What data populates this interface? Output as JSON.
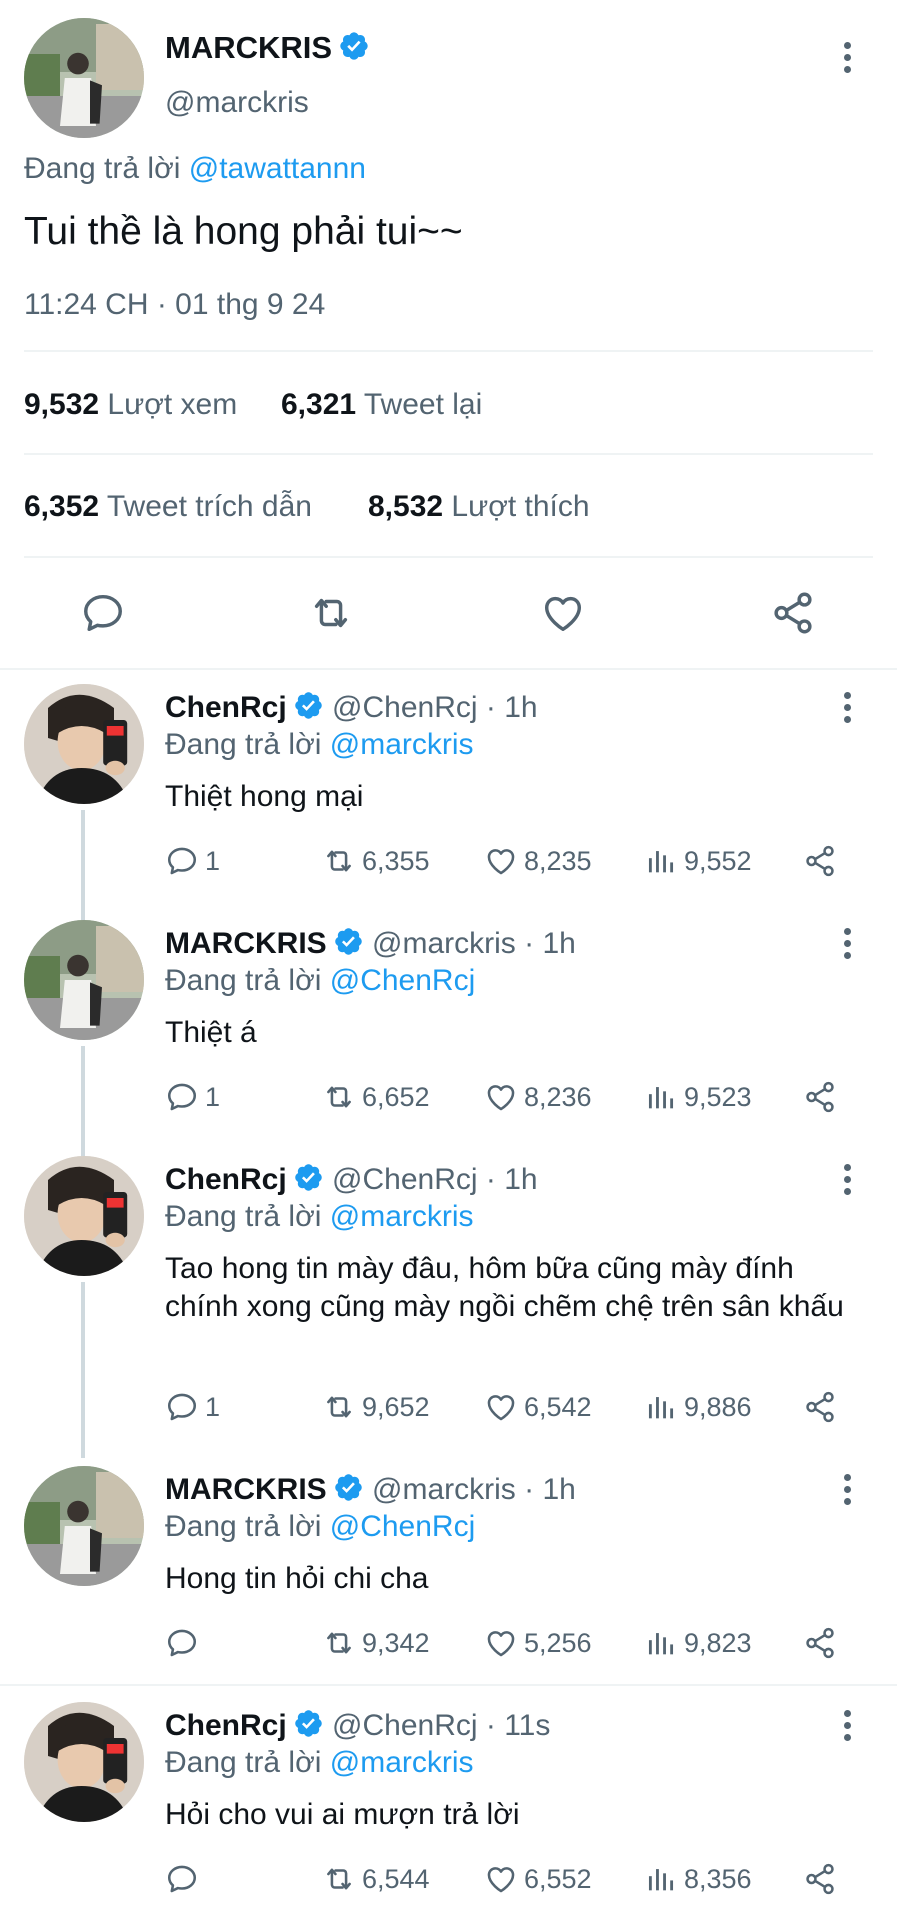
{
  "main_tweet": {
    "display_name": "MARCKRIS",
    "handle": "@marckris",
    "replying_prefix": "Đang trả lời",
    "replying_to": "@tawattannn",
    "text": "Tui thề là hong phải tui~~",
    "timestamp": "11:24 CH · 01 thg 9 24",
    "views_count": "9,532",
    "views_label": "Lượt xem",
    "retweets_count": "6,321",
    "retweets_label": "Tweet lại",
    "quotes_count": "6,352",
    "quotes_label": "Tweet trích dẫn",
    "likes_count": "8,532",
    "likes_label": "Lượt thích",
    "actions": [
      "reply-icon",
      "retweet-icon",
      "like-icon",
      "share-icon"
    ]
  },
  "replies": [
    {
      "display_name": "ChenRcj",
      "handle": "@ChenRcj",
      "time": "· 1h",
      "replying_prefix": "Đang trả lời",
      "replying_to": "@marckris",
      "text": "Thiệt hong mại",
      "replies": "1",
      "retweets": "6,355",
      "likes": "8,235",
      "views": "9,552"
    },
    {
      "display_name": "MARCKRIS",
      "handle": "@marckris",
      "time": "· 1h",
      "replying_prefix": "Đang trả lời",
      "replying_to": "@ChenRcj",
      "text": "Thiệt á",
      "replies": "1",
      "retweets": "6,652",
      "likes": "8,236",
      "views": "9,523"
    },
    {
      "display_name": "ChenRcj",
      "handle": "@ChenRcj",
      "time": "· 1h",
      "replying_prefix": "Đang trả lời",
      "replying_to": "@marckris",
      "text": "Tao hong tin mày đâu, hôm bữa cũng mày đính chính xong cũng mày ngồi chẽm chệ trên sân khấu",
      "replies": "1",
      "retweets": "9,652",
      "likes": "6,542",
      "views": "9,886"
    },
    {
      "display_name": "MARCKRIS",
      "handle": "@marckris",
      "time": "· 1h",
      "replying_prefix": "Đang trả lời",
      "replying_to": "@ChenRcj",
      "text": "Hong tin hỏi chi cha",
      "replies": "",
      "retweets": "9,342",
      "likes": "5,256",
      "views": "9,823"
    },
    {
      "display_name": "ChenRcj",
      "handle": "@ChenRcj",
      "time": "· 11s",
      "replying_prefix": "Đang trả lời",
      "replying_to": "@marckris",
      "text": "Hỏi cho vui ai mượn trả lời",
      "replies": "",
      "retweets": "6,544",
      "likes": "6,552",
      "views": "8,356"
    }
  ],
  "colors": {
    "accent": "#1d9bf0",
    "text": "#0f1419",
    "muted": "#536471",
    "divider": "#eff3f4"
  }
}
